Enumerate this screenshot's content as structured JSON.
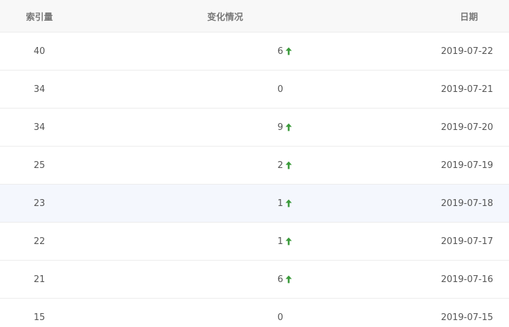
{
  "table": {
    "headers": {
      "index": "索引量",
      "change": "变化情况",
      "date": "日期"
    },
    "rows": [
      {
        "index": "40",
        "change": "6",
        "trend": "up",
        "date": "2019-07-22"
      },
      {
        "index": "34",
        "change": "0",
        "trend": "none",
        "date": "2019-07-21"
      },
      {
        "index": "34",
        "change": "9",
        "trend": "up",
        "date": "2019-07-20"
      },
      {
        "index": "25",
        "change": "2",
        "trend": "up",
        "date": "2019-07-19"
      },
      {
        "index": "23",
        "change": "1",
        "trend": "up",
        "date": "2019-07-18"
      },
      {
        "index": "22",
        "change": "1",
        "trend": "up",
        "date": "2019-07-17"
      },
      {
        "index": "21",
        "change": "6",
        "trend": "up",
        "date": "2019-07-16"
      },
      {
        "index": "15",
        "change": "0",
        "trend": "none",
        "date": "2019-07-15"
      }
    ],
    "hovered_row": 4
  },
  "icons": {
    "trend_up": "arrow-up-icon"
  },
  "colors": {
    "header_bg": "#f8f8f8",
    "header_text": "#787878",
    "body_text": "#555555",
    "row_hover_bg": "#f4f7fd",
    "border": "#ececec",
    "trend_up": "#3a9a3a"
  }
}
